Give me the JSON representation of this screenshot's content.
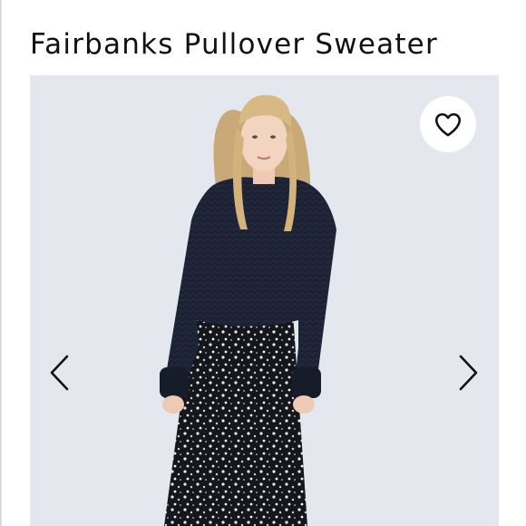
{
  "product": {
    "title": "Fairbanks Pullover Sweater"
  },
  "gallery": {
    "image_description_icon": "model-photo",
    "wishlist_icon": "heart-outline-icon",
    "prev_icon": "chevron-left-icon",
    "next_icon": "chevron-right-icon"
  },
  "colors": {
    "background": "#e4e8ee",
    "sweater": "#1c2233",
    "skirt": "#15171c",
    "text": "#111111"
  }
}
